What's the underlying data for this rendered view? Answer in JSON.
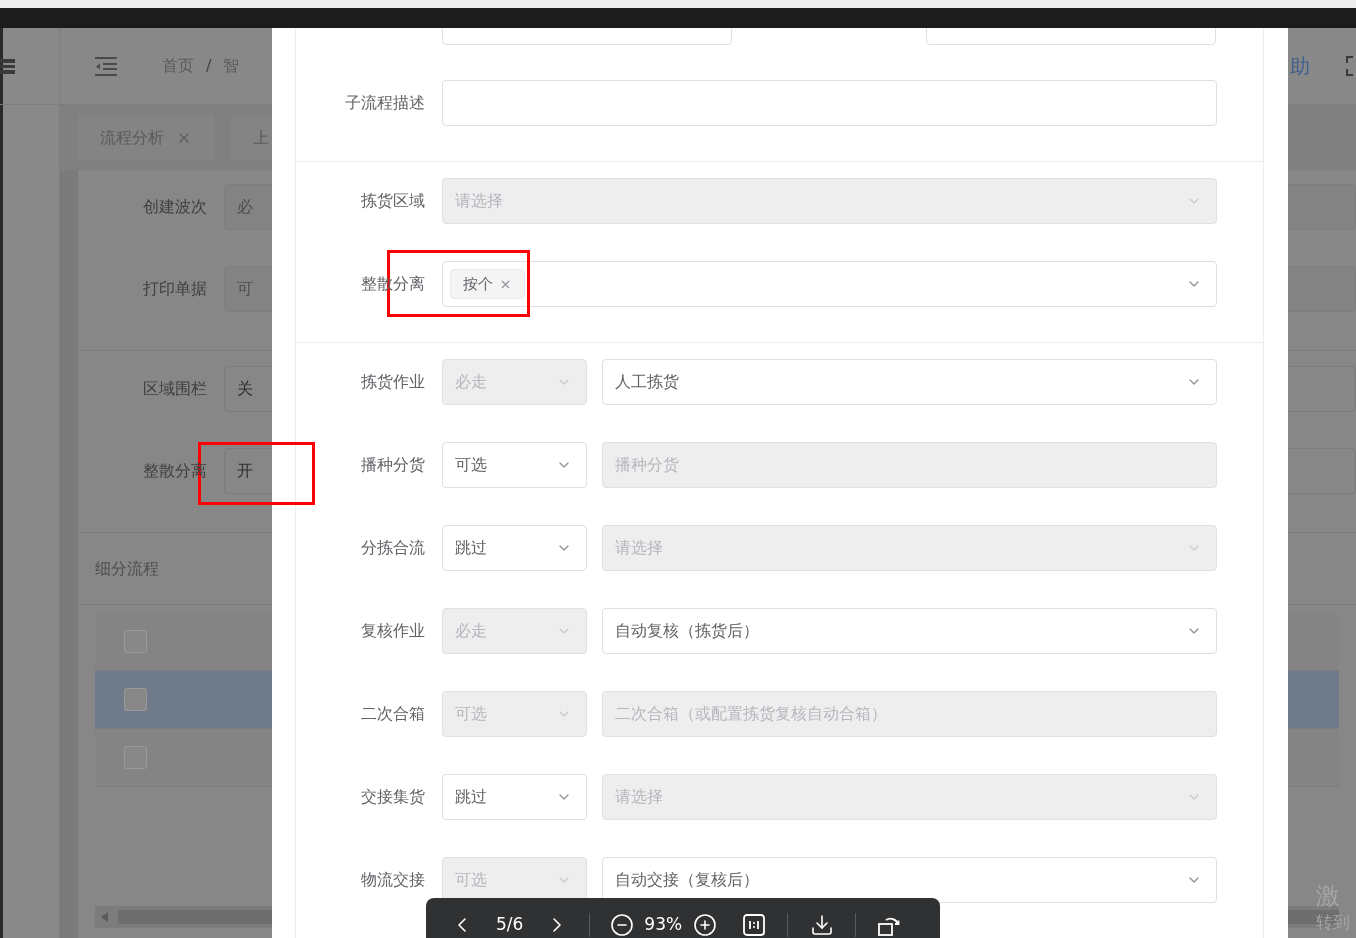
{
  "background": {
    "breadcrumb": [
      "首页",
      "智"
    ],
    "breadcrumb_separator": "/",
    "help": "助",
    "tabs": [
      {
        "label": "流程分析",
        "closable": true
      },
      {
        "label": "上",
        "closable": false
      }
    ],
    "sections": [
      [
        {
          "label": "创建波次",
          "value": "必",
          "disabled": true
        },
        {
          "label": "打印单据",
          "value": "可",
          "disabled": true
        }
      ],
      [
        {
          "label": "区域围栏",
          "value": "关",
          "disabled": false
        },
        {
          "label": "整散分离",
          "value": "开",
          "disabled": false
        }
      ]
    ],
    "section_title": "细分流程",
    "table_rows": [
      {
        "selected": false
      },
      {
        "selected": true
      },
      {
        "selected": false
      }
    ]
  },
  "image": {
    "sections": [
      {
        "rows": [
          {
            "label": "子流程描述",
            "fields": [
              {
                "kind": "input",
                "disabled": false
              }
            ]
          }
        ]
      },
      {
        "rows": [
          {
            "label": "拣货区域",
            "fields": [
              {
                "kind": "select",
                "placeholder": "请选择",
                "disabled": true
              }
            ]
          },
          {
            "label": "整散分离",
            "fields": [
              {
                "kind": "tags",
                "tags": [
                  "按个"
                ],
                "disabled": false
              }
            ]
          }
        ]
      },
      {
        "rows": [
          {
            "label": "拣货作业",
            "fields": [
              {
                "kind": "select",
                "value": "必走",
                "disabled": true
              },
              {
                "kind": "select",
                "value": "人工拣货",
                "disabled": false
              }
            ]
          },
          {
            "label": "播种分货",
            "fields": [
              {
                "kind": "select",
                "value": "可选",
                "disabled": false
              },
              {
                "kind": "input",
                "placeholder": "播种分货",
                "disabled": true
              }
            ]
          },
          {
            "label": "分拣合流",
            "fields": [
              {
                "kind": "select",
                "value": "跳过",
                "disabled": false
              },
              {
                "kind": "select",
                "placeholder": "请选择",
                "disabled": true
              }
            ]
          },
          {
            "label": "复核作业",
            "fields": [
              {
                "kind": "select",
                "value": "必走",
                "disabled": true
              },
              {
                "kind": "select",
                "value": "自动复核（拣货后）",
                "disabled": false
              }
            ]
          },
          {
            "label": "二次合箱",
            "fields": [
              {
                "kind": "select",
                "value": "可选",
                "disabled": true
              },
              {
                "kind": "input",
                "placeholder": "二次合箱（或配置拣货复核自动合箱）",
                "disabled": true
              }
            ]
          },
          {
            "label": "交接集货",
            "fields": [
              {
                "kind": "select",
                "value": "跳过",
                "disabled": false
              },
              {
                "kind": "select",
                "placeholder": "请选择",
                "disabled": true
              }
            ]
          },
          {
            "label": "物流交接",
            "fields": [
              {
                "kind": "select",
                "value": "可选",
                "disabled": true
              },
              {
                "kind": "select",
                "value": "自动交接（复核后）",
                "disabled": false
              }
            ]
          }
        ]
      }
    ]
  },
  "viewer_toolbar": {
    "page": "5/6",
    "zoom": "93%"
  },
  "activation_notice": [
    "激",
    "转到"
  ]
}
